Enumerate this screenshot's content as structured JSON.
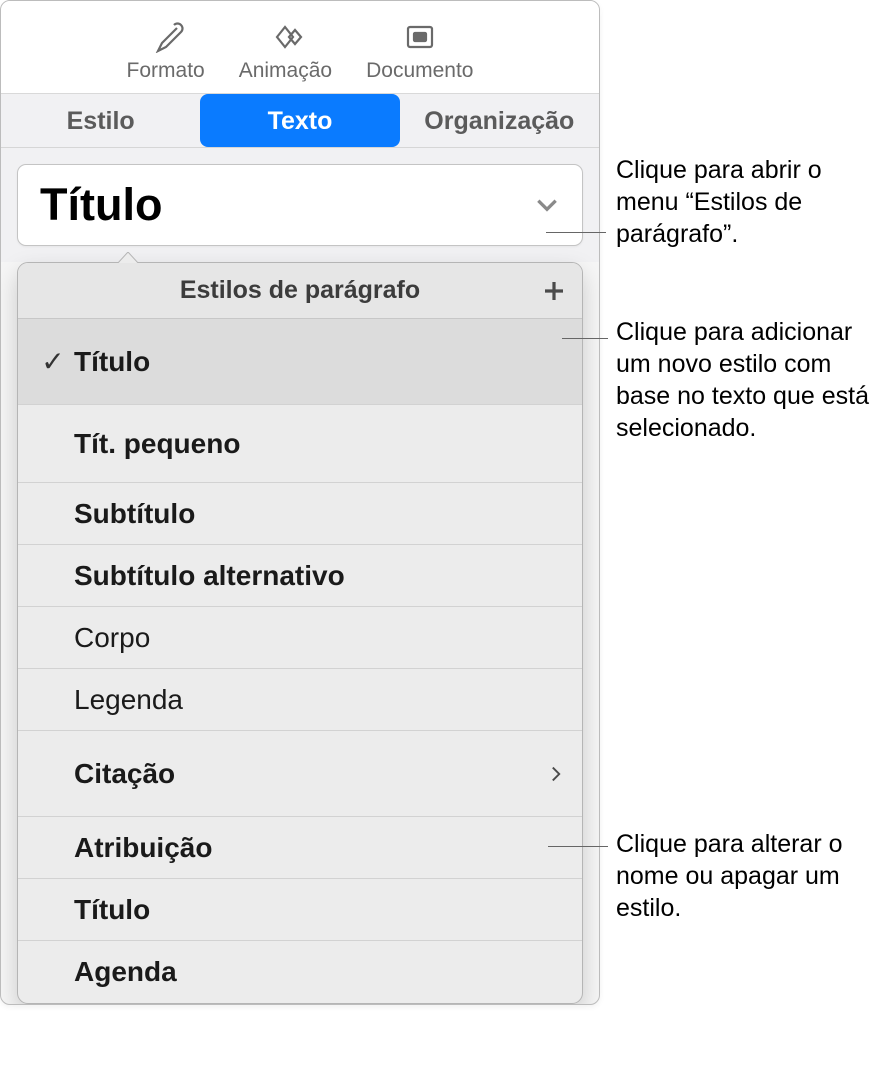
{
  "toolbar": {
    "format": "Formato",
    "animation": "Animação",
    "document": "Documento"
  },
  "segments": {
    "style": "Estilo",
    "text": "Texto",
    "organize": "Organização"
  },
  "current_style": "Título",
  "popover": {
    "title": "Estilos de parágrafo",
    "items": [
      {
        "label": "Título",
        "cls": "sz-title",
        "row": "h-big",
        "checked": true
      },
      {
        "label": "Tít. pequeno",
        "cls": "sz-titlesm",
        "row": "h-med"
      },
      {
        "label": "Subtítulo",
        "cls": "sz-sub",
        "row": "h-small"
      },
      {
        "label": "Subtítulo alternativo",
        "cls": "sz-subalt",
        "row": "h-small"
      },
      {
        "label": "Corpo",
        "cls": "sz-body",
        "row": "h-small"
      },
      {
        "label": "Legenda",
        "cls": "sz-caption",
        "row": "h-small"
      },
      {
        "label": "Citação",
        "cls": "sz-quote",
        "row": "h-big",
        "submenu": true
      },
      {
        "label": "Atribuição",
        "cls": "sz-attr",
        "row": "h-small"
      },
      {
        "label": "Título",
        "cls": "sz-headline",
        "row": "h-small"
      },
      {
        "label": "Agenda",
        "cls": "sz-agenda",
        "row": "h-small"
      }
    ]
  },
  "callouts": {
    "c1": "Clique para abrir o menu “Estilos de parágrafo”.",
    "c2": "Clique para adicionar um novo estilo com base no texto que está selecionado.",
    "c3": "Clique para alterar o nome ou apagar um estilo."
  }
}
